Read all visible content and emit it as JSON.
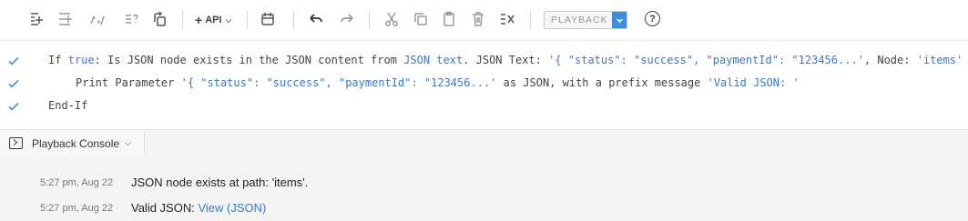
{
  "toolbar": {
    "icons": [
      "add-step-icon",
      "insert-step-icon",
      "edit-script-icon",
      "help-script-icon",
      "refresh-icon",
      "calendar-icon",
      "undo-icon",
      "redo-icon",
      "cut-icon",
      "copy-icon",
      "paste-icon",
      "delete-icon",
      "disable-icon",
      "chevron-down-icon",
      "help-icon"
    ],
    "api_label": "API",
    "playback_label": "PLAYBACK",
    "help_label": "?"
  },
  "script": {
    "rows": [
      {
        "prefix": "If ",
        "keyword": "true",
        "text_1": ": Is JSON node exists in the JSON content from ",
        "link_1": "JSON text",
        "text_2": ". JSON Text: ",
        "value_1": "'{ \"status\": \"success\", \"paymentId\": \"123456...'",
        "text_3": ", Node: ",
        "value_2": "'items'"
      },
      {
        "text_1": "Print Parameter ",
        "value_1": "'{ \"status\": \"success\", \"paymentId\": \"123456...'",
        "text_2": " as JSON, with a prefix message ",
        "value_2": "'Valid JSON: '"
      },
      {
        "text_1": "End-If"
      }
    ]
  },
  "console": {
    "tab_label": "Playback Console",
    "logs": [
      {
        "time": "5:27 pm, Aug 22",
        "message": "JSON node exists at path: 'items'."
      },
      {
        "time": "5:27 pm, Aug 22",
        "message": "Valid JSON: ",
        "link": "View (JSON)"
      }
    ]
  },
  "colors": {
    "accent": "#3d8de0",
    "keyword": "#3b78c5",
    "console_bg": "#f4f4f4"
  }
}
